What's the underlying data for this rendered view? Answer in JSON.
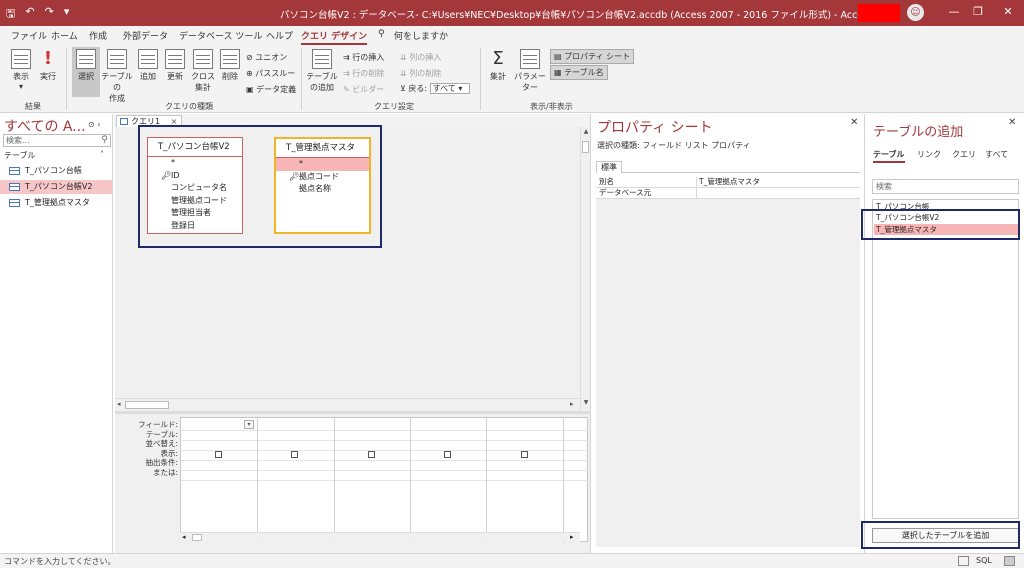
{
  "window": {
    "title": "パソコン台帳V2 : データベース- C:¥Users¥NEC¥Desktop¥台帳¥パソコン台帳V2.accdb (Access 2007 - 2016 ファイル形式)  -  Access",
    "qat_icons": [
      "save-icon",
      "undo-icon",
      "redo-icon",
      "customize-icon"
    ],
    "controls": {
      "minimize": "—",
      "restore": "❐",
      "close": "✕"
    }
  },
  "ribbon_tabs": [
    "ファイル",
    "ホーム",
    "作成",
    "外部データ",
    "データベース ツール",
    "ヘルプ",
    "クエリ デザイン"
  ],
  "tell_me": "何をしますか",
  "ribbon": {
    "results": {
      "view": "表示",
      "run": "実行",
      "label": "結果"
    },
    "query_type": {
      "select": "選択",
      "make_table_1": "テーブルの",
      "make_table_2": "作成",
      "append": "追加",
      "update": "更新",
      "crosstab_1": "クロス",
      "crosstab_2": "集計",
      "delete": "削除",
      "union": "ユニオン",
      "passthrough": "パススルー",
      "data_definition": "データ定義",
      "label": "クエリの種類"
    },
    "query_setup": {
      "show_table_1": "テーブル",
      "show_table_2": "の追加",
      "insert_rows": "行の挿入",
      "delete_rows": "行の削除",
      "builder": "ビルダー",
      "insert_columns": "列の挿入",
      "delete_columns": "列の削除",
      "return_label": "戻る:",
      "return_value": "すべて",
      "label": "クエリ設定"
    },
    "show_hide": {
      "totals": "集計",
      "parameters": "パラメーター",
      "property_sheet": "プロパティ シート",
      "table_names": "テーブル名",
      "label": "表示/非表示"
    }
  },
  "nav_pane": {
    "title": "すべての A...",
    "search_placeholder": "検索...",
    "category": "テーブル",
    "items": [
      {
        "label": "T_パソコン台帳",
        "selected": false
      },
      {
        "label": "T_パソコン台帳V2",
        "selected": true
      },
      {
        "label": "T_管理拠点マスタ",
        "selected": false
      }
    ]
  },
  "query_tab": {
    "label": "クエリ1",
    "close": "×"
  },
  "field_lists": [
    {
      "title": "T_パソコン台帳V2",
      "fields": [
        "*",
        "ID",
        "コンピュータ名",
        "管理拠点コード",
        "管理担当者",
        "登録日"
      ],
      "key_field": "ID"
    },
    {
      "title": "T_管理拠点マスタ",
      "fields": [
        "*",
        "拠点コード",
        "拠点名称"
      ],
      "key_field": "拠点コード"
    }
  ],
  "design_grid": {
    "row_labels": [
      "フィールド:",
      "テーブル:",
      "並べ替え:",
      "表示:",
      "抽出条件:",
      "または:"
    ],
    "columns": 5
  },
  "property_sheet": {
    "title": "プロパティ シート",
    "selection_type": "選択の種類: フィールド リスト プロパティ",
    "tab": "標準",
    "rows": [
      {
        "name": "別名",
        "value": "T_管理拠点マスタ"
      },
      {
        "name": "データベース元",
        "value": ""
      }
    ]
  },
  "add_tables": {
    "title": "テーブルの追加",
    "tabs": [
      "テーブル",
      "リンク",
      "クエリ",
      "すべて"
    ],
    "search_placeholder": "検索",
    "items": [
      {
        "label": "T_パソコン台帳",
        "selected": false
      },
      {
        "label": "T_パソコン台帳V2",
        "selected": false
      },
      {
        "label": "T_管理拠点マスタ",
        "selected": true
      }
    ],
    "add_button": "選択したテーブルを追加"
  },
  "status": {
    "text": "コマンドを入力してください。",
    "sql_label": "SQL"
  },
  "colors": {
    "accent": "#a4373a",
    "selection": "#f7b5b6",
    "highlight_frame": "#1f2a6a"
  }
}
